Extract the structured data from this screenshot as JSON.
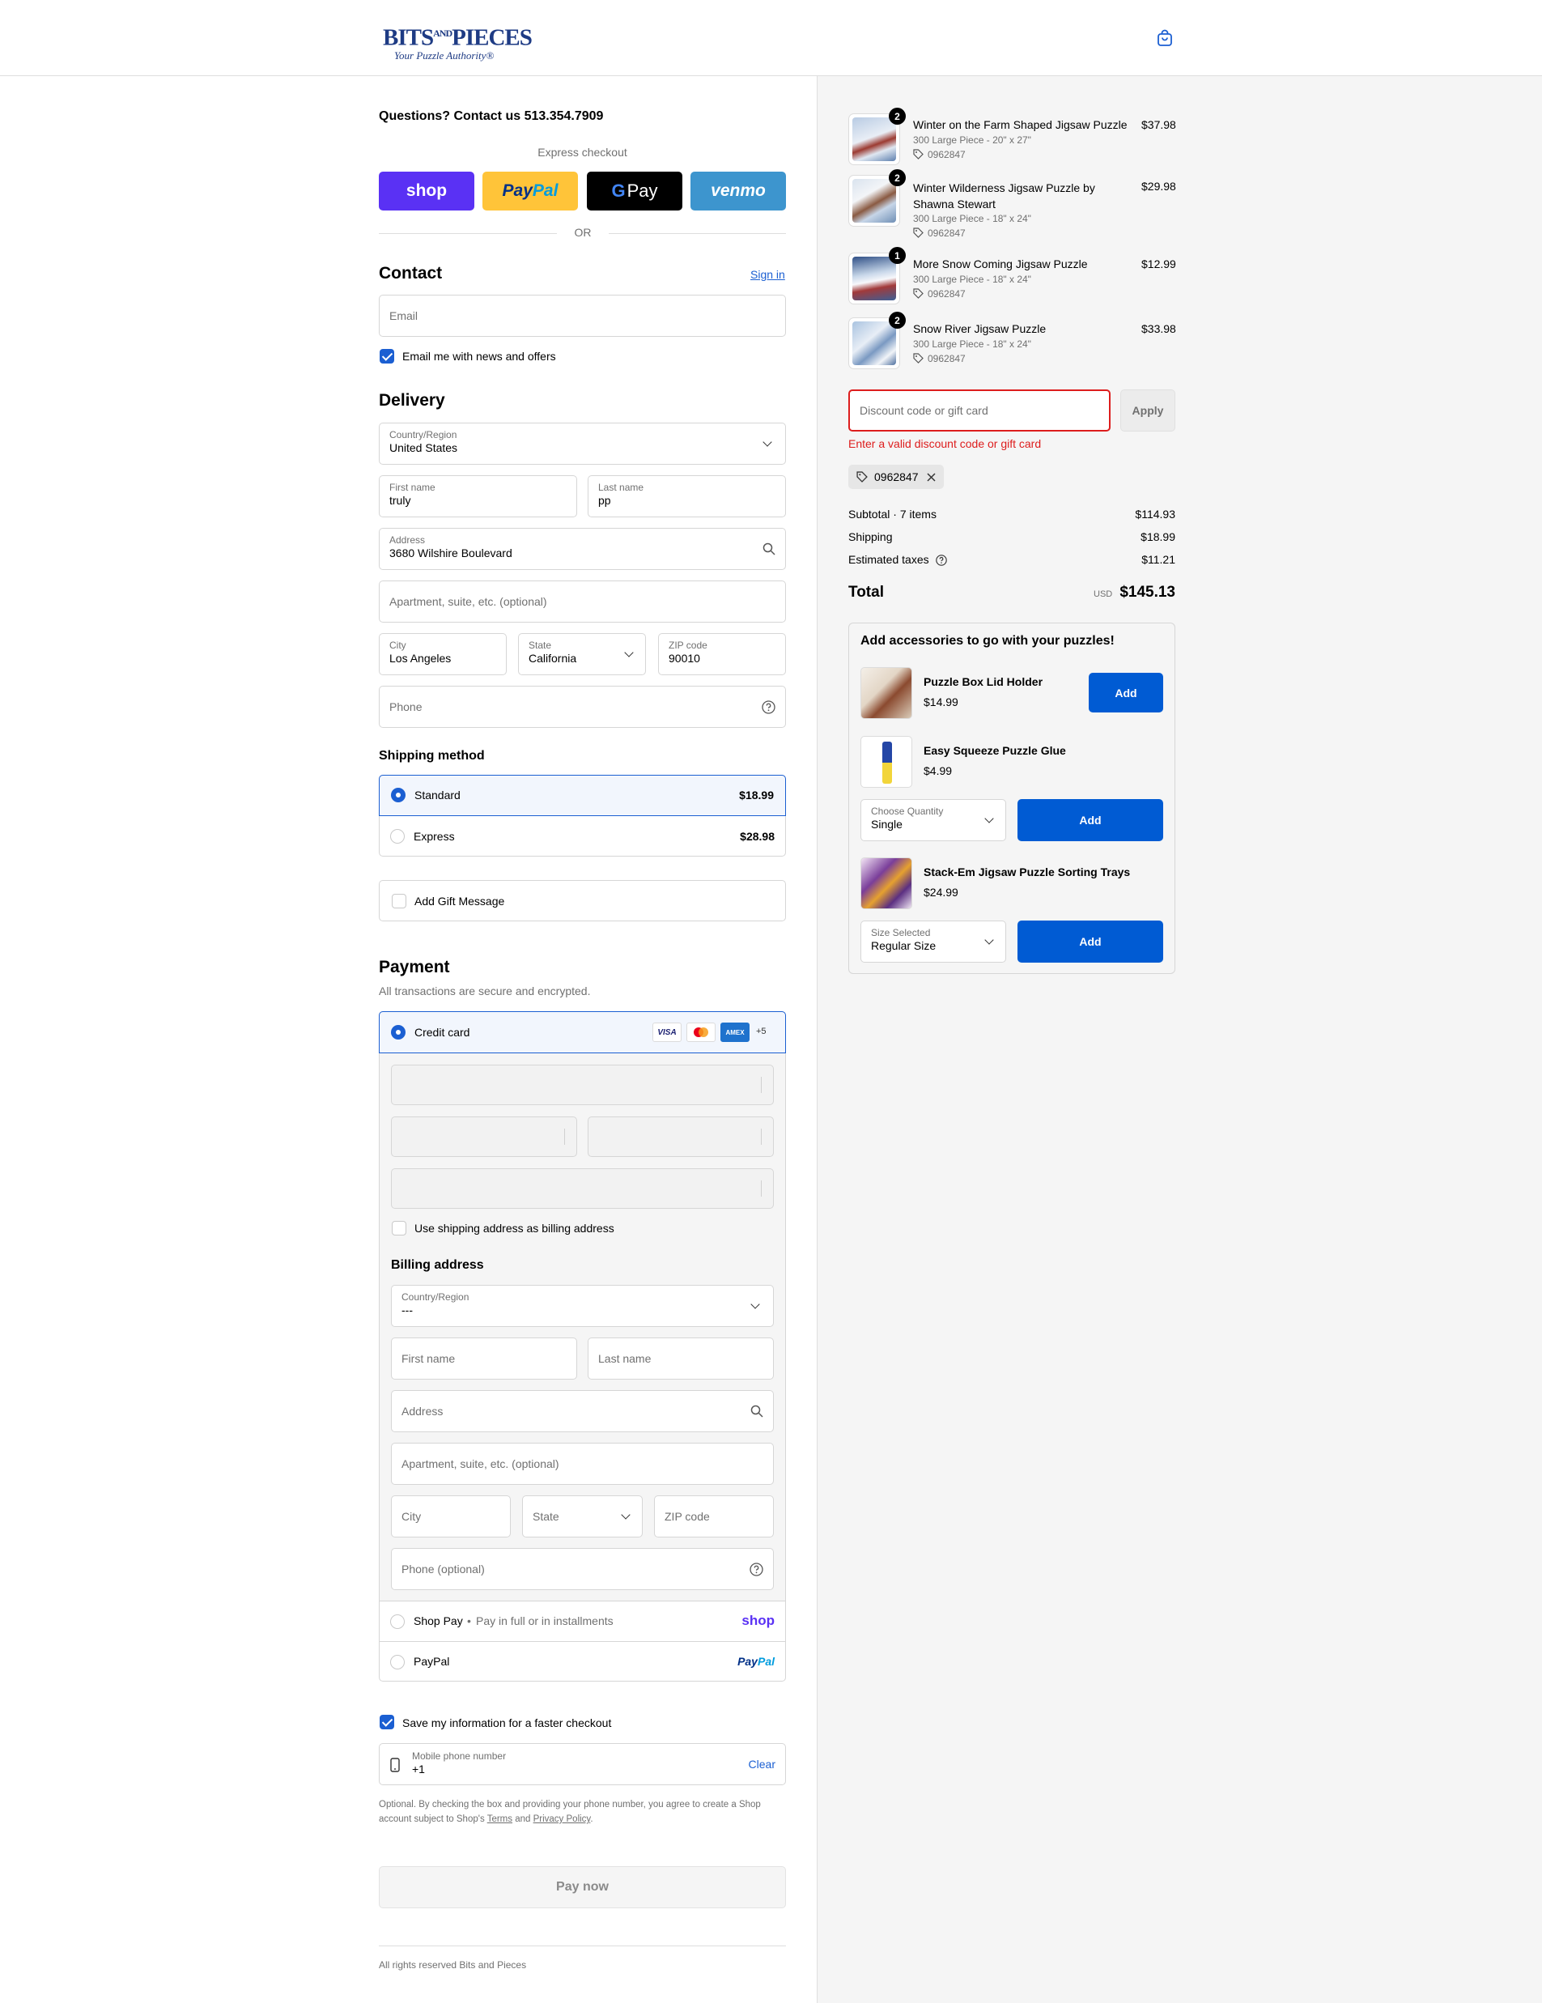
{
  "header": {
    "brand_top": "BITS",
    "brand_and": "AND",
    "brand_bottom": "PIECES",
    "tagline": "Your Puzzle Authority®"
  },
  "contact_line": "Questions? Contact us 513.354.7909",
  "express": {
    "label": "Express checkout",
    "buttons": [
      "shop",
      "PayPal",
      "G Pay",
      "venmo"
    ],
    "or": "OR"
  },
  "contact": {
    "heading": "Contact",
    "sign_in": "Sign in",
    "email_placeholder": "Email",
    "newsletter_label": "Email me with news and offers",
    "newsletter_checked": true
  },
  "delivery": {
    "heading": "Delivery",
    "country_label": "Country/Region",
    "country_value": "United States",
    "first_label": "First name",
    "first_value": "truly",
    "last_label": "Last name",
    "last_value": "pp",
    "address_label": "Address",
    "address_value": "3680 Wilshire Boulevard",
    "apt_placeholder": "Apartment, suite, etc. (optional)",
    "city_label": "City",
    "city_value": "Los Angeles",
    "state_label": "State",
    "state_value": "California",
    "zip_label": "ZIP code",
    "zip_value": "90010",
    "phone_placeholder": "Phone"
  },
  "shipping": {
    "heading": "Shipping method",
    "options": [
      {
        "name": "Standard",
        "price": "$18.99",
        "selected": true
      },
      {
        "name": "Express",
        "price": "$28.98",
        "selected": false
      }
    ],
    "gift_label": "Add Gift Message"
  },
  "payment": {
    "heading": "Payment",
    "subtitle": "All transactions are secure and encrypted.",
    "credit_label": "Credit card",
    "card_brands": [
      "VISA",
      "mastercard",
      "AMEX"
    ],
    "more_cards": "+5",
    "use_shipping_label": "Use shipping address as billing address",
    "billing_heading": "Billing address",
    "billing": {
      "country_label": "Country/Region",
      "country_value": "---",
      "first_placeholder": "First name",
      "last_placeholder": "Last name",
      "address_placeholder": "Address",
      "apt_placeholder": "Apartment, suite, etc. (optional)",
      "city_placeholder": "City",
      "state_placeholder": "State",
      "zip_placeholder": "ZIP code",
      "phone_placeholder": "Phone (optional)"
    },
    "shoppay_label": "Shop Pay",
    "shoppay_sub": "Pay in full or in installments",
    "shoppay_logo": "shop",
    "paypal_label": "PayPal",
    "paypal_logo": "PayPal"
  },
  "remember": {
    "label": "Save my information for a faster checkout",
    "checked": true,
    "phone_label": "Mobile phone number",
    "phone_value": "+1",
    "clear": "Clear",
    "legal_1": "Optional. By checking the box and providing your phone number, you agree to create a Shop",
    "legal_2": "account subject to Shop's",
    "terms": "Terms",
    "and": "and",
    "privacy": "Privacy Policy",
    "period": "."
  },
  "pay_now": "Pay now",
  "footer": "All rights reserved Bits and Pieces",
  "summary": {
    "items": [
      {
        "qty": "2",
        "title": "Winter on the Farm Shaped Jigsaw Puzzle",
        "variant": "300 Large Piece - 20\" x 27\"",
        "code": "0962847",
        "price": "$37.98"
      },
      {
        "qty": "2",
        "title_1": "Winter Wilderness Jigsaw Puzzle by",
        "title_2": "Shawna Stewart",
        "variant": "300 Large Piece - 18\" x 24\"",
        "code": "0962847",
        "price": "$29.98"
      },
      {
        "qty": "1",
        "title": "More Snow Coming Jigsaw Puzzle",
        "variant": "300 Large Piece - 18\" x 24\"",
        "code": "0962847",
        "price": "$12.99"
      },
      {
        "qty": "2",
        "title": "Snow River Jigsaw Puzzle",
        "variant": "300 Large Piece - 18\" x 24\"",
        "code": "0962847",
        "price": "$33.98"
      }
    ],
    "discount_placeholder": "Discount code or gift card",
    "apply": "Apply",
    "error": "Enter a valid discount code or gift card",
    "applied_code": "0962847",
    "subtotal_label": "Subtotal · 7 items",
    "subtotal": "$114.93",
    "shipping_label": "Shipping",
    "shipping": "$18.99",
    "taxes_label": "Estimated taxes",
    "taxes": "$11.21",
    "total_label": "Total",
    "currency": "USD",
    "total": "$145.13"
  },
  "accessories": {
    "heading": "Add accessories to go with your puzzles!",
    "items": [
      {
        "name": "Puzzle Box Lid Holder",
        "price": "$14.99",
        "add": "Add"
      },
      {
        "name": "Easy Squeeze Puzzle Glue",
        "price": "$4.99",
        "select_label": "Choose Quantity",
        "select_value": "Single",
        "add": "Add"
      },
      {
        "name": "Stack-Em Jigsaw Puzzle Sorting Trays",
        "price": "$24.99",
        "select_label": "Size Selected",
        "select_value": "Regular Size",
        "add": "Add"
      }
    ]
  },
  "colors": {
    "accent": "#1b5fd2",
    "shop_purple": "#5a31f4",
    "paypal_yellow": "#ffc439",
    "venmo_blue": "#3d95ce",
    "error_red": "#dd1d1d",
    "add_button": "#005bd3"
  }
}
